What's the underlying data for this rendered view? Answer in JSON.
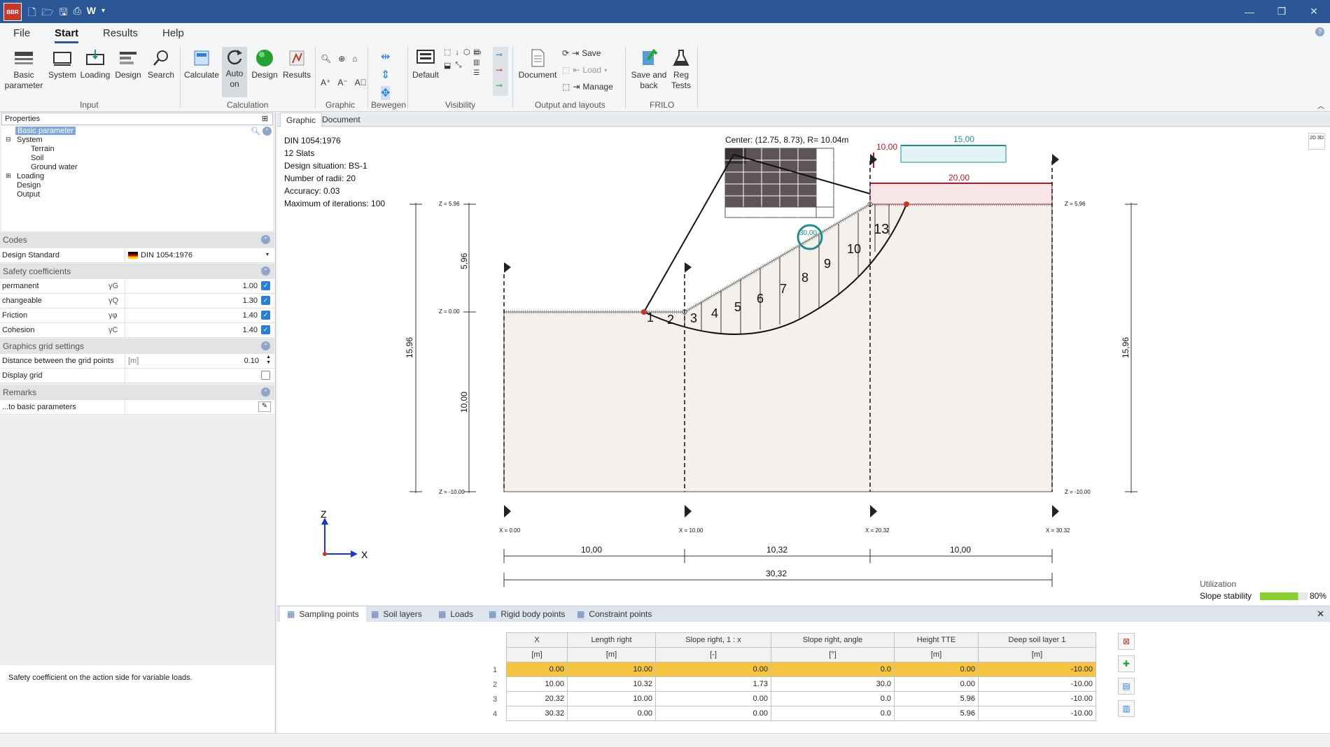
{
  "titlebar": {
    "app_icon": "BBR",
    "quick_access": [
      "new-icon",
      "open-icon",
      "save-icon",
      "print-icon",
      "W",
      "dropdown-icon"
    ],
    "window_controls": [
      "—",
      "❐",
      "✕"
    ]
  },
  "menu": [
    "File",
    "Start",
    "Results",
    "Help"
  ],
  "ribbon": {
    "input": {
      "group": "Input",
      "buttons": [
        "Basic parameter",
        "System",
        "Loading",
        "Design",
        "Search"
      ]
    },
    "calculation": {
      "group": "Calculation",
      "buttons": [
        "Calculate",
        "Auto on",
        "Design",
        "Results"
      ]
    },
    "graphic": {
      "group": "Graphic"
    },
    "bewegen": {
      "group": "Bewegen"
    },
    "visibility": {
      "group": "Visibility",
      "button": "Default"
    },
    "output": {
      "group": "Output and layouts",
      "document": "Document",
      "save": "Save",
      "load": "Load",
      "manage": "Manage"
    },
    "frilo": {
      "group": "FRILO",
      "save_back": "Save and back",
      "reg_tests": "Reg Tests"
    }
  },
  "properties": {
    "header": "Properties",
    "tree": [
      "Basic parameter",
      "System",
      "Terrain",
      "Soil",
      "Ground water",
      "Loading",
      "Design",
      "Output"
    ],
    "sections": {
      "codes": "Codes",
      "safety": "Safety coefficients",
      "grid": "Graphics grid settings",
      "remarks": "Remarks"
    },
    "design_standard": {
      "label": "Design Standard",
      "value": "DIN 1054:1976"
    },
    "coefficients": [
      {
        "label": "permanent",
        "symbol": "γG",
        "value": "1.00"
      },
      {
        "label": "changeable",
        "symbol": "γQ",
        "value": "1.30"
      },
      {
        "label": "Friction",
        "symbol": "γφ",
        "value": "1.40"
      },
      {
        "label": "Cohesion",
        "symbol": "γC",
        "value": "1.40"
      }
    ],
    "grid_distance": {
      "label": "Distance between the grid points",
      "unit": "[m]",
      "value": "0.10"
    },
    "display_grid": {
      "label": "Display grid"
    },
    "remarks_row": {
      "label": "...to basic parameters"
    },
    "help_text": "Safety coefficient on the action side for variable loads."
  },
  "doc_tabs": [
    "Graphic",
    "Document"
  ],
  "graphic": {
    "info": [
      "DIN 1054:1976",
      "12 Slats",
      "Design situation: BS-1",
      "Number of radii: 20",
      "Accuracy: 0.03",
      "Maximum of iterations: 100"
    ],
    "center": "Center: (12.75, 8.73), R= 10.04m",
    "load1": "10,00",
    "load2": "15,00",
    "load3": "20,00",
    "angle": "30,00",
    "z_top": "Z = 5.96",
    "z_zero": "Z = 0.00",
    "z_bot": "Z = -10.00",
    "dim_596": "5,96",
    "dim_1000v": "10,00",
    "dim_1596": "15,96",
    "xlabels": [
      "X = 0.00",
      "X = 10.00",
      "X = 20.32",
      "X = 30.32"
    ],
    "dims": [
      "10,00",
      "10,32",
      "10,00"
    ],
    "total": "30,32",
    "slats": [
      "1",
      "2",
      "3",
      "4",
      "5",
      "6",
      "7",
      "8",
      "9",
      "10",
      "13"
    ],
    "axis_z": "Z",
    "axis_x": "X",
    "view_toggle": "2D 3D",
    "utilization": {
      "title": "Utilization",
      "label": "Slope stability",
      "value": "80%",
      "fraction": 0.8
    }
  },
  "bottom": {
    "tabs": [
      "Sampling points",
      "Soil layers",
      "Loads",
      "Rigid body points",
      "Constraint points"
    ],
    "headers": [
      "X",
      "Length right",
      "Slope right, 1 : x",
      "Slope right, angle",
      "Height TTE",
      "Deep soil layer 1"
    ],
    "units": [
      "[m]",
      "[m]",
      "[-]",
      "[°]",
      "[m]",
      "[m]"
    ],
    "rows": [
      [
        "0.00",
        "10.00",
        "0.00",
        "0.0",
        "0.00",
        "-10.00"
      ],
      [
        "10.00",
        "10.32",
        "1.73",
        "30.0",
        "0.00",
        "-10.00"
      ],
      [
        "20.32",
        "10.00",
        "0.00",
        "0.0",
        "5.96",
        "-10.00"
      ],
      [
        "30.32",
        "0.00",
        "0.00",
        "0.0",
        "5.96",
        "-10.00"
      ]
    ],
    "row_numbers": [
      "1",
      "2",
      "3",
      "4"
    ]
  },
  "colors": {
    "titlebar": "#2b5797",
    "selected_row": "#f5c542",
    "load_red": "#b5172a",
    "load_teal": "#1e8c8c"
  }
}
